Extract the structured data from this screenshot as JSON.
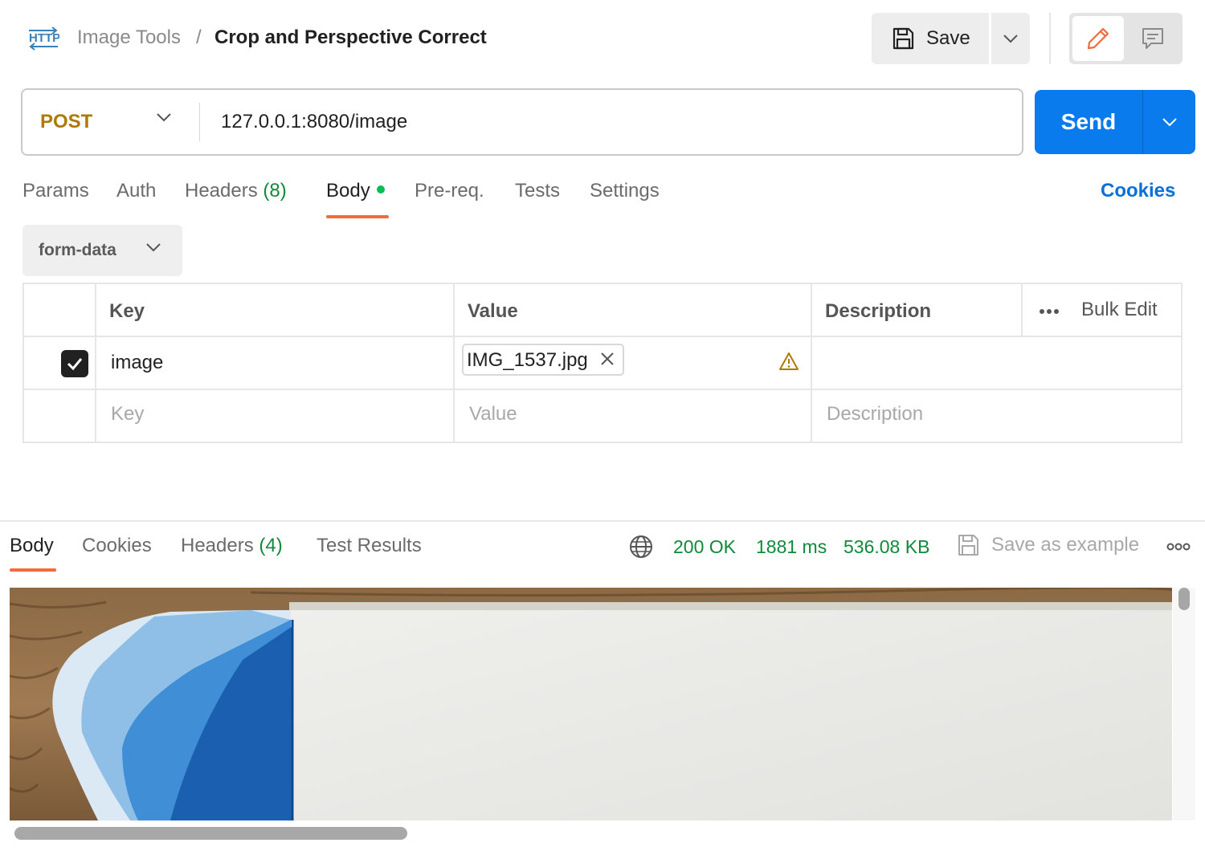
{
  "header": {
    "collection": "Image Tools",
    "separator": "/",
    "request_name": "Crop and Perspective Correct",
    "save_label": "Save"
  },
  "request": {
    "method": "POST",
    "url": "127.0.0.1:8080/image",
    "send_label": "Send"
  },
  "request_tabs": [
    {
      "label": "Params"
    },
    {
      "label": "Auth"
    },
    {
      "label": "Headers",
      "count": "(8)"
    },
    {
      "label": "Body"
    },
    {
      "label": "Pre-req."
    },
    {
      "label": "Tests"
    },
    {
      "label": "Settings"
    }
  ],
  "active_request_tab": "Body",
  "cookies_link": "Cookies",
  "body_type": "form-data",
  "table": {
    "headers": [
      "Key",
      "Value",
      "Description"
    ],
    "bulk_edit": "Bulk Edit",
    "rows": [
      {
        "checked": true,
        "key": "image",
        "value_file": "IMG_1537.jpg",
        "description": ""
      }
    ],
    "placeholder": {
      "key": "Key",
      "value": "Value",
      "description": "Description"
    }
  },
  "response": {
    "tabs": [
      {
        "label": "Body"
      },
      {
        "label": "Cookies"
      },
      {
        "label": "Headers",
        "count": "(4)"
      },
      {
        "label": "Test Results"
      }
    ],
    "active_tab": "Body",
    "status": "200 OK",
    "time": "1881 ms",
    "size": "536.08 KB",
    "save_example": "Save as example"
  },
  "colors": {
    "accent_blue": "#097bed",
    "method_post": "#ad7a03",
    "status_green": "#0f8a3a",
    "active_tab_underline": "#f26b3a",
    "body_dot": "#0cbb52"
  },
  "icons": [
    "http-icon",
    "save-icon",
    "chevron-down-icon",
    "pencil-icon",
    "comment-icon",
    "checkmark-icon",
    "close-icon",
    "warning-icon",
    "more-dots-icon",
    "globe-icon"
  ]
}
